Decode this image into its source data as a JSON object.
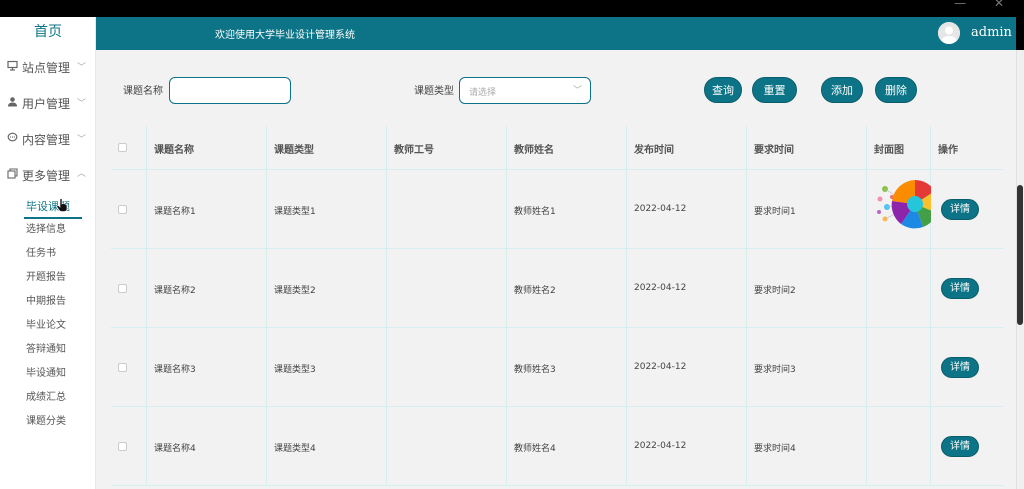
{
  "window": {
    "controls": "— ✕"
  },
  "sidebar": {
    "home": "首页",
    "menus": [
      {
        "label": "站点管理",
        "icon": "monitor-icon"
      },
      {
        "label": "用户管理",
        "icon": "user-icon"
      },
      {
        "label": "内容管理",
        "icon": "chat-icon"
      },
      {
        "label": "更多管理",
        "icon": "copy-icon"
      }
    ],
    "subitems": [
      "毕设课题",
      "选择信息",
      "任务书",
      "开题报告",
      "中期报告",
      "毕业论文",
      "答辩通知",
      "毕设通知",
      "成绩汇总",
      "课题分类"
    ]
  },
  "header": {
    "title": "欢迎使用大学毕业设计管理系统",
    "user": "admin"
  },
  "search": {
    "name_label": "课题名称",
    "name_value": "",
    "type_label": "课题类型",
    "type_placeholder": "请选择"
  },
  "buttons": {
    "query": "查询",
    "reset": "重置",
    "add": "添加",
    "delete": "删除"
  },
  "table": {
    "columns": [
      "课题名称",
      "课题类型",
      "教师工号",
      "教师姓名",
      "发布时间",
      "要求时间",
      "封面图",
      "操作"
    ],
    "rows": [
      {
        "name": "课题名称1",
        "type": "课题类型1",
        "teacher_id": "",
        "teacher_name": "教师姓名1",
        "publish": "2022-04-12",
        "required": "要求时间1",
        "has_cover": true,
        "action": "详情"
      },
      {
        "name": "课题名称2",
        "type": "课题类型2",
        "teacher_id": "",
        "teacher_name": "教师姓名2",
        "publish": "2022-04-12",
        "required": "要求时间2",
        "has_cover": false,
        "action": "详情"
      },
      {
        "name": "课题名称3",
        "type": "课题类型3",
        "teacher_id": "",
        "teacher_name": "教师姓名3",
        "publish": "2022-04-12",
        "required": "要求时间3",
        "has_cover": false,
        "action": "详情"
      },
      {
        "name": "课题名称4",
        "type": "课题类型4",
        "teacher_id": "",
        "teacher_name": "教师姓名4",
        "publish": "2022-04-12",
        "required": "要求时间4",
        "has_cover": false,
        "action": "详情"
      }
    ]
  },
  "colors": {
    "primary": "#0c7486",
    "background": "#f2f2f2",
    "border": "#d6eef0"
  }
}
